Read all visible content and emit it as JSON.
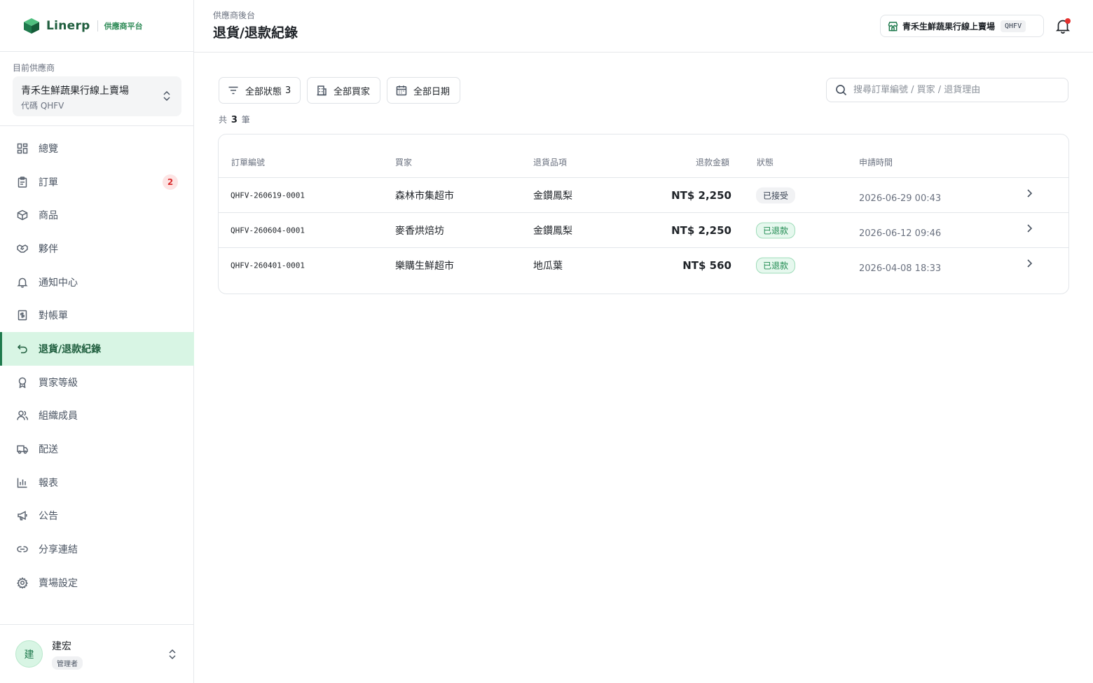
{
  "brand": {
    "name": "Linerp",
    "subtitle": "供應商平台"
  },
  "supplier": {
    "label": "目前供應商",
    "name": "青禾生鮮蔬果行線上賣場",
    "code": "代碼 QHFV"
  },
  "nav": [
    {
      "label": "總覽",
      "icon": "dashboard-icon"
    },
    {
      "label": "訂單",
      "icon": "clipboard-icon",
      "badge": "2"
    },
    {
      "label": "商品",
      "icon": "package-icon"
    },
    {
      "label": "夥伴",
      "icon": "handshake-icon"
    },
    {
      "label": "通知中心",
      "icon": "bell-icon"
    },
    {
      "label": "對帳單",
      "icon": "receipt-icon"
    },
    {
      "label": "退貨/退款紀錄",
      "icon": "return-arrow-icon",
      "active": true
    },
    {
      "label": "買家等級",
      "icon": "award-icon"
    },
    {
      "label": "組織成員",
      "icon": "users-icon"
    },
    {
      "label": "配送",
      "icon": "truck-icon"
    },
    {
      "label": "報表",
      "icon": "bar-chart-icon"
    },
    {
      "label": "公告",
      "icon": "megaphone-icon"
    },
    {
      "label": "分享連結",
      "icon": "link-icon"
    },
    {
      "label": "賣場設定",
      "icon": "gear-icon"
    }
  ],
  "user": {
    "avatar": "建",
    "name": "建宏",
    "role": "管理者"
  },
  "header": {
    "breadcrumb": "供應商後台",
    "title": "退貨/退款紀錄",
    "store_name": "青禾生鮮蔬果行線上賣場",
    "store_code": "QHFV"
  },
  "filters": {
    "status_label": "全部狀態",
    "status_count": "3",
    "buyer_label": "全部買家",
    "date_label": "全部日期",
    "search_placeholder": "搜尋訂單編號 / 買家 / 退貨理由"
  },
  "count": {
    "prefix": "共",
    "value": "3",
    "suffix": "筆"
  },
  "table": {
    "columns": [
      "訂單編號",
      "買家",
      "退貨品項",
      "退款金額",
      "狀態",
      "申請時間"
    ],
    "rows": [
      {
        "order": "QHFV-260619-0001",
        "buyer": "森林市集超市",
        "item": "金鑽鳳梨",
        "amount": "NT$ 2,250",
        "status": "已接受",
        "status_kind": "accepted",
        "time": "2026-06-29 00:43"
      },
      {
        "order": "QHFV-260604-0001",
        "buyer": "麥香烘焙坊",
        "item": "金鑽鳳梨",
        "amount": "NT$ 2,250",
        "status": "已退款",
        "status_kind": "refunded",
        "time": "2026-06-12 09:46"
      },
      {
        "order": "QHFV-260401-0001",
        "buyer": "樂購生鮮超市",
        "item": "地瓜葉",
        "amount": "NT$ 560",
        "status": "已退款",
        "status_kind": "refunded",
        "time": "2026-04-08 18:33"
      }
    ]
  },
  "colors": {
    "accent": "#1f7a4d",
    "active_bg": "#d8f5e4",
    "badge_red": "#d92d2d"
  }
}
